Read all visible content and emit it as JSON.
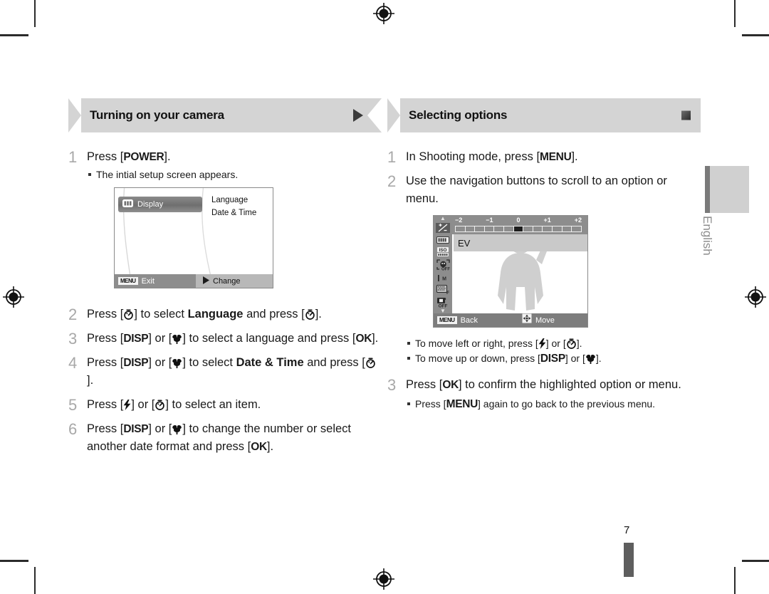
{
  "page": {
    "number": "7",
    "language_tab": "English"
  },
  "left_column": {
    "banner": {
      "title": "Turning on your camera",
      "mark": "triangle-right-icon"
    },
    "steps": [
      {
        "num": "1",
        "parts": [
          {
            "t": "text",
            "v": "Press ["
          },
          {
            "t": "kb",
            "v": "POWER"
          },
          {
            "t": "text",
            "v": "]."
          }
        ],
        "bullets": [
          "The intial setup screen appears."
        ]
      },
      {
        "num": "2",
        "parts": [
          {
            "t": "text",
            "v": "Press ["
          },
          {
            "t": "icon",
            "v": "self-timer-icon"
          },
          {
            "t": "text",
            "v": "] to select "
          },
          {
            "t": "bold",
            "v": "Language"
          },
          {
            "t": "text",
            "v": " and press ["
          },
          {
            "t": "icon",
            "v": "self-timer-icon"
          },
          {
            "t": "text",
            "v": "]."
          }
        ],
        "bullets": []
      },
      {
        "num": "3",
        "parts": [
          {
            "t": "text",
            "v": "Press ["
          },
          {
            "t": "kb",
            "v": "DISP"
          },
          {
            "t": "text",
            "v": "] or ["
          },
          {
            "t": "icon",
            "v": "macro-flower-icon"
          },
          {
            "t": "text",
            "v": "] to select a language and press ["
          },
          {
            "t": "kb",
            "v": "OK"
          },
          {
            "t": "text",
            "v": "]."
          }
        ],
        "bullets": []
      },
      {
        "num": "4",
        "parts": [
          {
            "t": "text",
            "v": "Press ["
          },
          {
            "t": "kb",
            "v": "DISP"
          },
          {
            "t": "text",
            "v": "] or ["
          },
          {
            "t": "icon",
            "v": "macro-flower-icon"
          },
          {
            "t": "text",
            "v": "] to select "
          },
          {
            "t": "bold",
            "v": "Date & Time"
          },
          {
            "t": "text",
            "v": " and press ["
          },
          {
            "t": "icon",
            "v": "self-timer-icon"
          },
          {
            "t": "text",
            "v": "]."
          }
        ],
        "bullets": []
      },
      {
        "num": "5",
        "parts": [
          {
            "t": "text",
            "v": "Press ["
          },
          {
            "t": "icon",
            "v": "flash-icon"
          },
          {
            "t": "text",
            "v": "] or ["
          },
          {
            "t": "icon",
            "v": "self-timer-icon"
          },
          {
            "t": "text",
            "v": "] to select an item."
          }
        ],
        "bullets": []
      },
      {
        "num": "6",
        "parts": [
          {
            "t": "text",
            "v": "Press ["
          },
          {
            "t": "kb",
            "v": "DISP"
          },
          {
            "t": "text",
            "v": "] or ["
          },
          {
            "t": "icon",
            "v": "macro-flower-icon"
          },
          {
            "t": "text",
            "v": "] to change the number or select another date format and press ["
          },
          {
            "t": "kb",
            "v": "OK"
          },
          {
            "t": "text",
            "v": "]."
          }
        ],
        "bullets": []
      }
    ],
    "lcd": {
      "tab_label": "Display",
      "tab_icon": "display-icon",
      "menu_items": [
        "Language",
        "Date & Time"
      ],
      "bottom_left_chip": "MENU",
      "bottom_left_label": "Exit",
      "bottom_right_icon": "triangle-right-icon",
      "bottom_right_label": "Change"
    }
  },
  "right_column": {
    "banner": {
      "title": "Selecting options",
      "mark": "square-mark-icon"
    },
    "steps_top": [
      {
        "num": "1",
        "parts": [
          {
            "t": "text",
            "v": "In Shooting mode, press ["
          },
          {
            "t": "kb",
            "v": "MENU"
          },
          {
            "t": "text",
            "v": "]."
          }
        ]
      },
      {
        "num": "2",
        "parts": [
          {
            "t": "text",
            "v": "Use the navigation buttons to scroll to an option or menu."
          }
        ]
      }
    ],
    "lcd": {
      "ev_labels": [
        "−2",
        "−1",
        "0",
        "+1",
        "+2"
      ],
      "ev_total_ticks": 13,
      "ev_selected_tick": 6,
      "ev_row_label": "EV",
      "side_icons": [
        "exposure-value-icon",
        "white-balance-icon",
        "iso-icon",
        "face-detection-off-icon",
        "focus-area-icon",
        "image-quality-icon",
        "voice-memo-off-icon"
      ],
      "scroll_up_icon": "chevron-up-icon",
      "scroll_down_icon": "chevron-down-icon",
      "bottom_left_chip": "MENU",
      "bottom_left_label": "Back",
      "bottom_right_icon": "navigation-pad-icon",
      "bottom_right_label": "Move"
    },
    "bullets_after_lcd": [
      [
        {
          "t": "text",
          "v": "To move left or right, press ["
        },
        {
          "t": "icon",
          "v": "flash-icon"
        },
        {
          "t": "text",
          "v": "] or ["
        },
        {
          "t": "icon",
          "v": "self-timer-icon"
        },
        {
          "t": "text",
          "v": "]."
        }
      ],
      [
        {
          "t": "text",
          "v": "To move up or down, press ["
        },
        {
          "t": "kb",
          "v": "DISP"
        },
        {
          "t": "text",
          "v": "] or ["
        },
        {
          "t": "icon",
          "v": "macro-flower-icon"
        },
        {
          "t": "text",
          "v": "]."
        }
      ]
    ],
    "step_three": {
      "num": "3",
      "parts": [
        {
          "t": "text",
          "v": "Press ["
        },
        {
          "t": "kb",
          "v": "OK"
        },
        {
          "t": "text",
          "v": "] to confirm the highlighted option or menu."
        }
      ],
      "bullets": [
        [
          {
            "t": "text",
            "v": "Press ["
          },
          {
            "t": "kb",
            "v": "MENU"
          },
          {
            "t": "text",
            "v": "] again to go back to the previous menu."
          }
        ]
      ]
    }
  },
  "colors": {
    "banner_bg": "#d4d4d4",
    "step_num": "#a8a8a8",
    "lcd_bar": "#8d8d8d",
    "side_tab": "#d0d0d0",
    "page_bar": "#5e5e5e"
  }
}
